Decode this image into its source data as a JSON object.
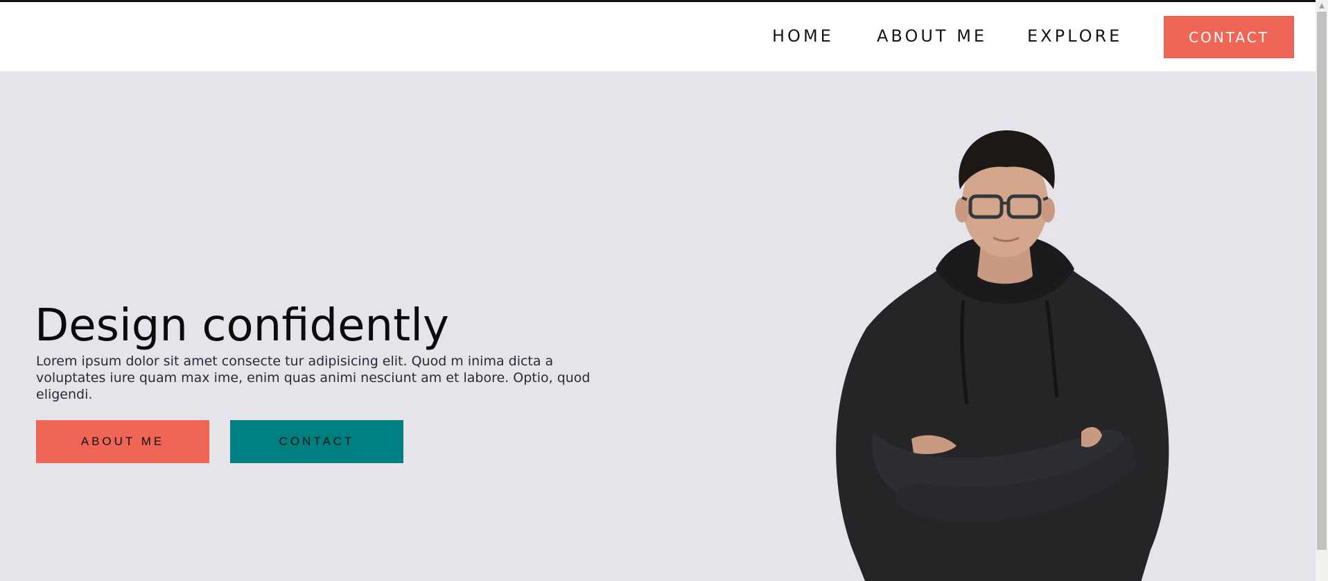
{
  "nav": {
    "links": [
      {
        "label": "HOME"
      },
      {
        "label": "ABOUT ME"
      },
      {
        "label": "EXPLORE"
      }
    ],
    "contact_label": "CONTACT"
  },
  "hero": {
    "title": "Design confidently",
    "description": "Lorem ipsum dolor sit amet consecte tur adipisicing elit. Quod m inima dicta a voluptates iure quam max ime, enim quas animi nesciunt am et labore. Optio, quod eligendi.",
    "buttons": {
      "about_label": "ABOUT ME",
      "contact_label": "CONTACT"
    }
  },
  "scrollbar": {
    "up_arrow_icon": "chevron-up-icon"
  },
  "colors": {
    "accent": "#f06656",
    "teal": "#007f80",
    "hero_background": "#e6e4eb",
    "nav_background": "#ffffff"
  }
}
